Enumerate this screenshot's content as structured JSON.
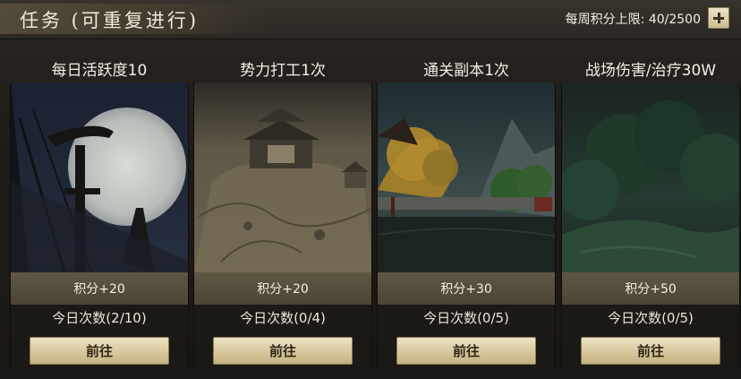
{
  "header": {
    "title": "任务 (可重复进行)",
    "weekly_limit": "每周积分上限: 40/2500"
  },
  "tasks": [
    {
      "title": "每日活跃度10",
      "points": "积分+20",
      "count": "今日次数(2/10)",
      "button": "前往"
    },
    {
      "title": "势力打工1次",
      "points": "积分+20",
      "count": "今日次数(0/4)",
      "button": "前往"
    },
    {
      "title": "通关副本1次",
      "points": "积分+30",
      "count": "今日次数(0/5)",
      "button": "前往"
    },
    {
      "title": "战场伤害/治疗30W",
      "points": "积分+50",
      "count": "今日次数(0/5)",
      "button": "前往"
    }
  ]
}
